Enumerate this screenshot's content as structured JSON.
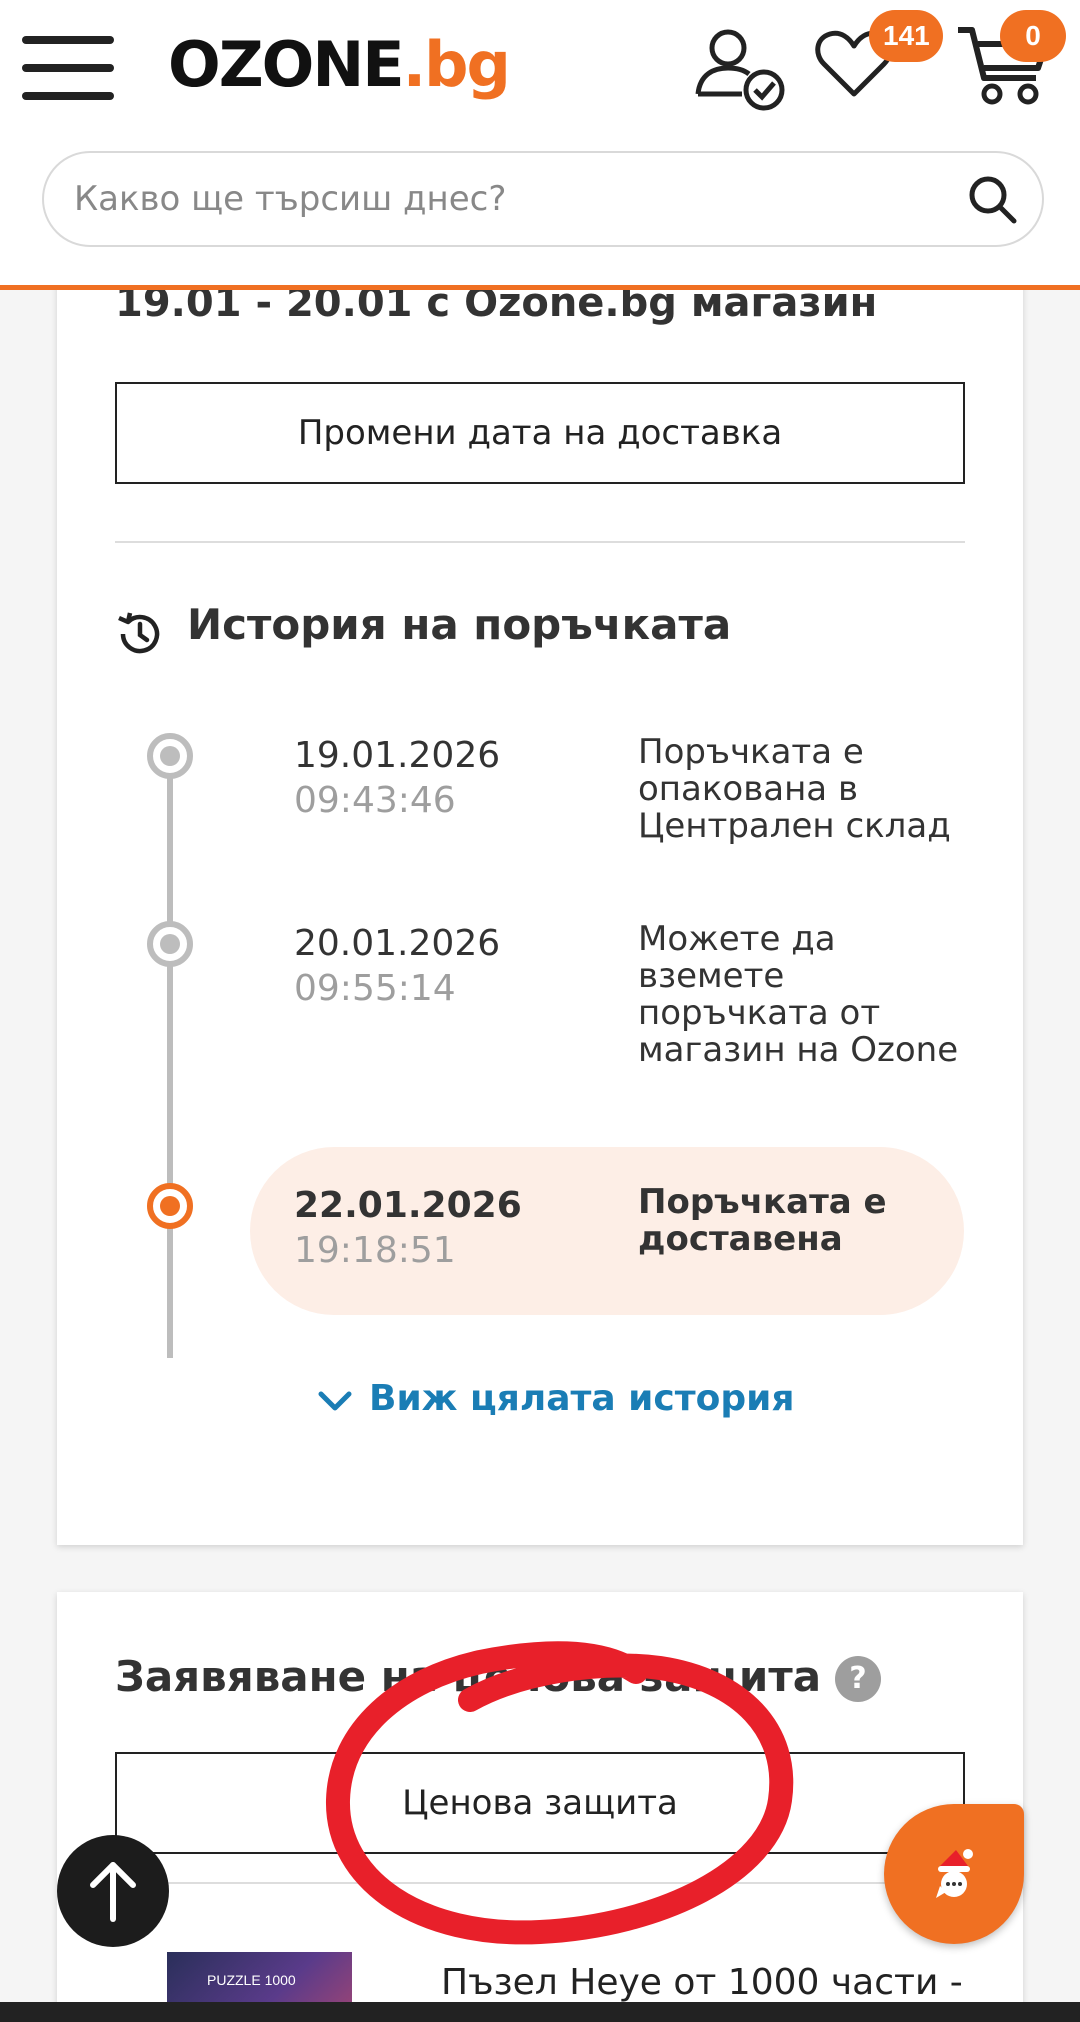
{
  "header": {
    "logo_main": "OZONE",
    "logo_tld": ".bg",
    "wishlist_count": "141",
    "cart_count": "0",
    "search_placeholder": "Какво ще търсиш днес?"
  },
  "order": {
    "delivery_title": "19.01 - 20.01 с Ozone.bg магазин",
    "change_date_label": "Промени дата на доставка",
    "history_title": "История на поръчката",
    "history": [
      {
        "date": "19.01.2026",
        "time": "09:43:46",
        "description": "Поръчката е опакована в Централен склад"
      },
      {
        "date": "20.01.2026",
        "time": "09:55:14",
        "description": "Можете да вземете поръчката от магазин на Ozone"
      },
      {
        "date": "22.01.2026",
        "time": "19:18:51",
        "description": "Поръчката е доставена"
      }
    ],
    "view_all_label": "Виж цялата история"
  },
  "price_protection": {
    "title": "Заявяване на ценова защита",
    "help_label": "?",
    "button_label": "Ценова защита",
    "product_title": "Пъзел Heye от 1000 части -",
    "product_thumb_text": "PUZZLE 1000"
  },
  "colors": {
    "accent": "#f07022",
    "link": "#1a7db5",
    "annotation": "#e8202a"
  }
}
